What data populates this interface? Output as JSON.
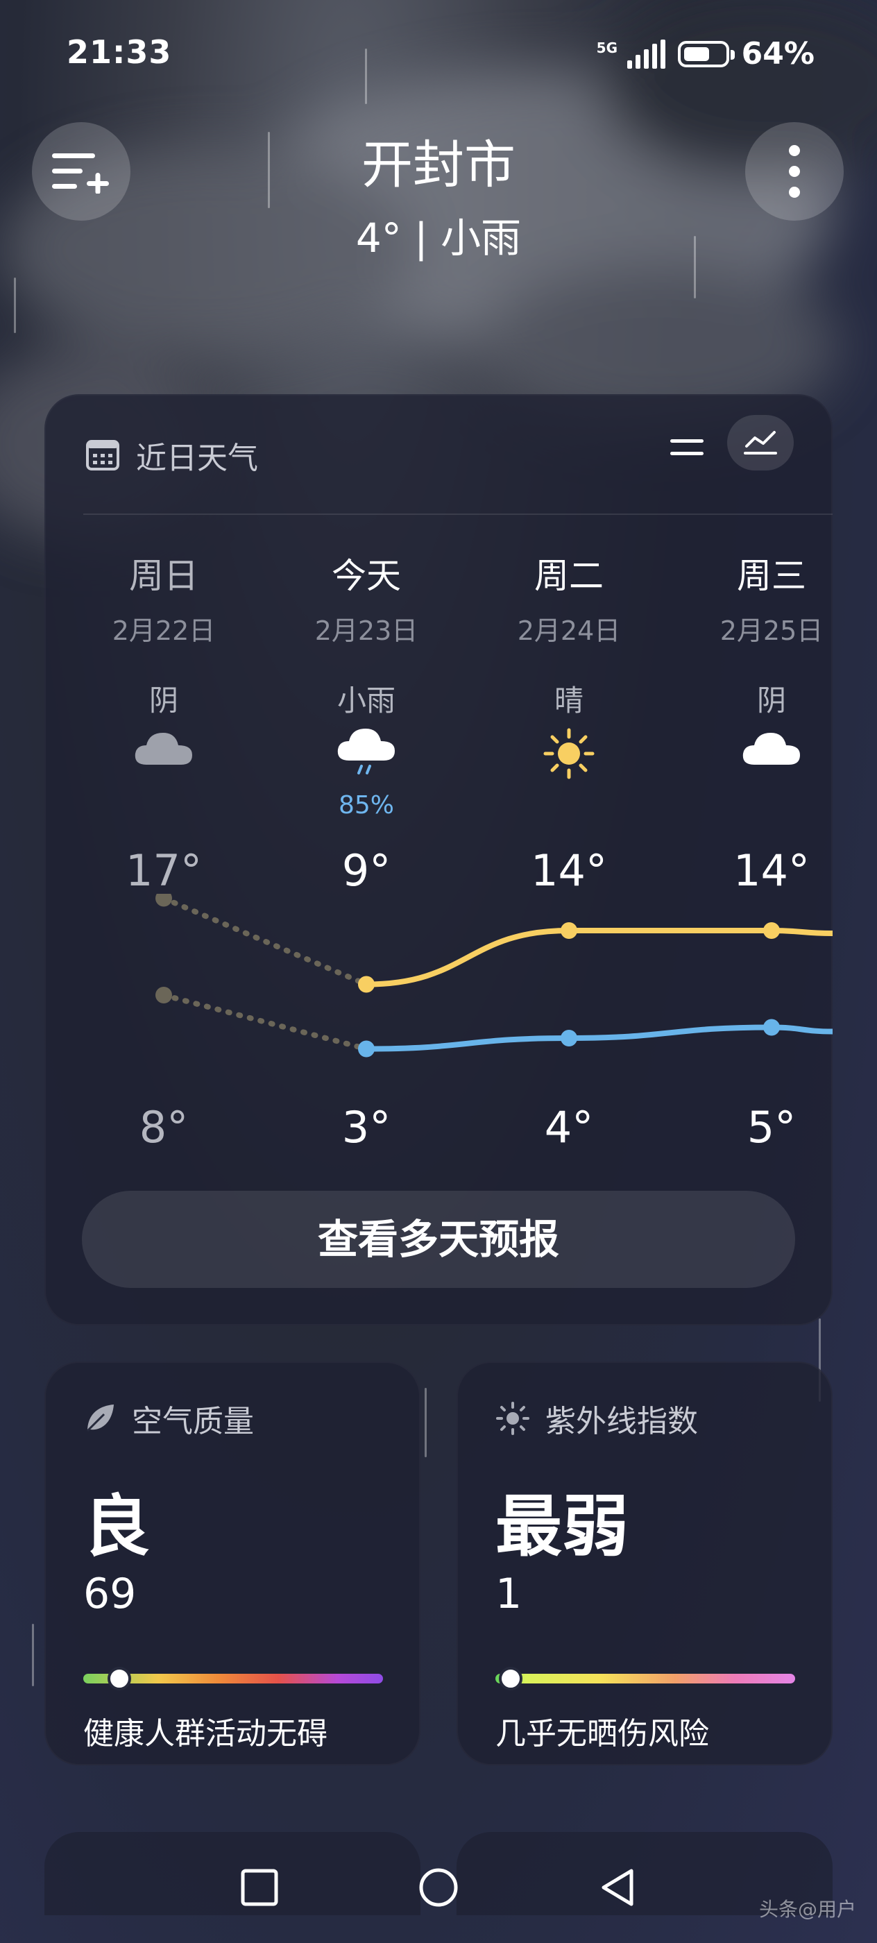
{
  "status_bar": {
    "time": "21:33",
    "network": "5G",
    "battery": "64%",
    "battery_level": 0.64
  },
  "header": {
    "city": "开封市",
    "current": "4° | 小雨"
  },
  "forecast": {
    "title": "近日天气",
    "days": [
      {
        "name": "周日",
        "date": "2月22日",
        "cond": "阴",
        "icon": "cloud-gray-icon",
        "precip": "",
        "high": "17°",
        "low": "8°",
        "high_val": 17,
        "low_val": 8
      },
      {
        "name": "今天",
        "date": "2月23日",
        "cond": "小雨",
        "icon": "rain-cloud-icon",
        "precip": "85%",
        "high": "9°",
        "low": "3°",
        "high_val": 9,
        "low_val": 3
      },
      {
        "name": "周二",
        "date": "2月24日",
        "cond": "晴",
        "icon": "sun-icon",
        "precip": "",
        "high": "14°",
        "low": "4°",
        "high_val": 14,
        "low_val": 4
      },
      {
        "name": "周三",
        "date": "2月25日",
        "cond": "阴",
        "icon": "cloud-white-icon",
        "precip": "",
        "high": "14°",
        "low": "5°",
        "high_val": 14,
        "low_val": 5
      }
    ],
    "more_label": "查看多天预报",
    "colors": {
      "high": "#f8cf62",
      "low": "#68b4ea",
      "past": "#6b6658"
    }
  },
  "air_quality": {
    "title": "空气质量",
    "level": "良",
    "value": "69",
    "position": 0.12,
    "desc": "健康人群活动无碍"
  },
  "uv": {
    "title": "紫外线指数",
    "level": "最弱",
    "value": "1",
    "position": 0.05,
    "desc": "几乎无晒伤风险"
  },
  "watermark": "头条@用户"
}
